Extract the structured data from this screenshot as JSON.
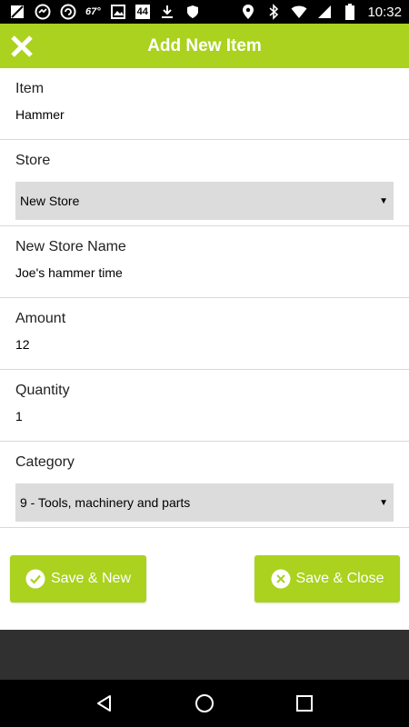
{
  "status_bar": {
    "temperature": "67°",
    "badge": "44",
    "time": "10:32"
  },
  "app_bar": {
    "title": "Add New Item"
  },
  "form": {
    "item": {
      "label": "Item",
      "value": "Hammer"
    },
    "store": {
      "label": "Store",
      "selected": "New Store"
    },
    "new_store_name": {
      "label": "New Store Name",
      "value": "Joe's hammer time"
    },
    "amount": {
      "label": "Amount",
      "value": "12"
    },
    "quantity": {
      "label": "Quantity",
      "value": "1"
    },
    "category": {
      "label": "Category",
      "selected": "9 - Tools, machinery and parts"
    }
  },
  "buttons": {
    "save_new": "Save & New",
    "save_close": "Save & Close"
  },
  "colors": {
    "accent": "#aad21e",
    "select_bg": "#dcdcdc",
    "status_bar": "#000000",
    "dark_strip": "#303030"
  }
}
